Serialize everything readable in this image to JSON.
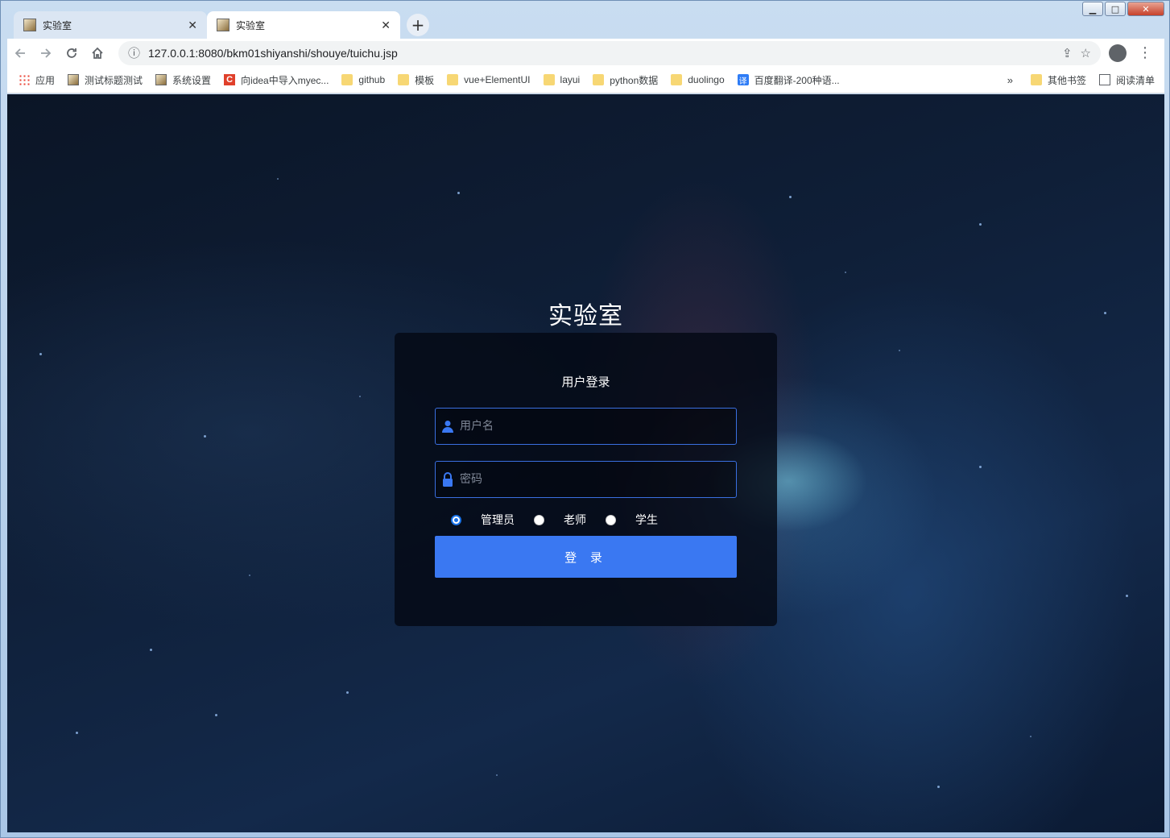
{
  "browser": {
    "tabs": [
      {
        "title": "实验室",
        "active": false
      },
      {
        "title": "实验室",
        "active": true
      }
    ],
    "url": "127.0.0.1:8080/bkm01shiyanshi/shouye/tuichu.jsp",
    "bookmarks": [
      {
        "label": "应用",
        "icon": "apps-icon"
      },
      {
        "label": "测试标题测试",
        "icon": "page-icon"
      },
      {
        "label": "系统设置",
        "icon": "page-icon"
      },
      {
        "label": "向idea中导入myec...",
        "icon": "c-logo-icon"
      },
      {
        "label": "github",
        "icon": "folder-icon"
      },
      {
        "label": "模板",
        "icon": "folder-icon"
      },
      {
        "label": "vue+ElementUI",
        "icon": "folder-icon"
      },
      {
        "label": "layui",
        "icon": "folder-icon"
      },
      {
        "label": "python数据",
        "icon": "folder-icon"
      },
      {
        "label": "duolingo",
        "icon": "folder-icon"
      },
      {
        "label": "百度翻译-200种语...",
        "icon": "translate-icon"
      }
    ],
    "bookmarks_right": [
      {
        "label": "其他书签",
        "icon": "folder-icon"
      },
      {
        "label": "阅读清单",
        "icon": "reading-list-icon"
      }
    ],
    "overflow": "»",
    "translate_glyph": "译",
    "c_glyph": "C"
  },
  "page": {
    "site_title": "实验室",
    "login": {
      "heading": "用户登录",
      "username_placeholder": "用户名",
      "password_placeholder": "密码",
      "roles": [
        {
          "label": "管理员",
          "checked": true
        },
        {
          "label": "老师",
          "checked": false
        },
        {
          "label": "学生",
          "checked": false
        }
      ],
      "submit_label": "登 录"
    },
    "accent_color": "#3a78f2"
  }
}
